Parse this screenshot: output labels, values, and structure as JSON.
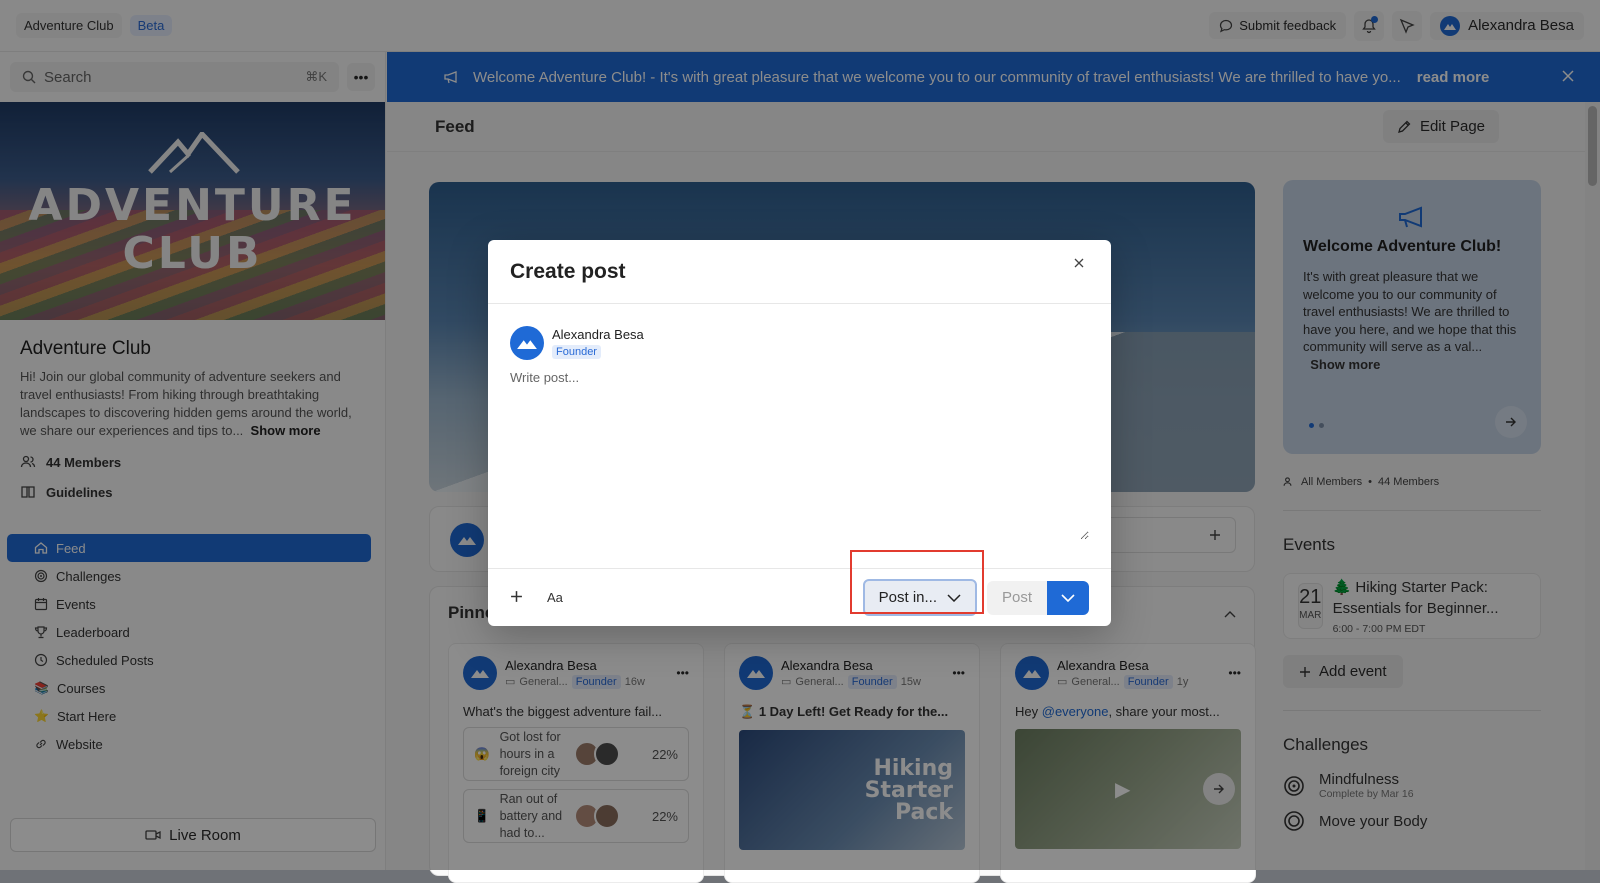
{
  "topbar": {
    "community": "Adventure Club",
    "beta": "Beta",
    "feedback": "Submit feedback",
    "user": "Alexandra Besa"
  },
  "sidebar": {
    "search_placeholder": "Search",
    "search_shortcut": "⌘K",
    "banner_text_1": "ADVENTURE",
    "banner_text_2": "CLUB",
    "title": "Adventure Club",
    "description": "Hi! Join our global community of adventure seekers and travel enthusiasts! From hiking through breathtaking landscapes to discovering hidden gems around the world, we share our experiences and tips to...",
    "show_more": "Show more",
    "members": "44 Members",
    "guidelines": "Guidelines",
    "nav": [
      {
        "label": "Feed",
        "icon": "home-icon"
      },
      {
        "label": "Challenges",
        "icon": "target-icon"
      },
      {
        "label": "Events",
        "icon": "calendar-icon"
      },
      {
        "label": "Leaderboard",
        "icon": "trophy-icon"
      },
      {
        "label": "Scheduled Posts",
        "icon": "clock-icon"
      },
      {
        "label": "Courses",
        "icon": "books-icon"
      },
      {
        "label": "Start Here",
        "icon": "star-icon"
      },
      {
        "label": "Website",
        "icon": "link-icon"
      }
    ],
    "live_room": "Live Room"
  },
  "announcement": {
    "text": "Welcome Adventure Club! - It's with great pleasure that we welcome you to our community of travel enthusiasts! We are thrilled to have yo...",
    "read_more": "read more"
  },
  "feed": {
    "title": "Feed",
    "edit_page": "Edit Page",
    "pinned_label": "Pinned",
    "cards": [
      {
        "author": "Alexandra Besa",
        "channel": "General...",
        "role": "Founder",
        "age": "16w",
        "text": "What's the biggest adventure fail...",
        "poll": [
          {
            "emoji": "😱",
            "text": "Got lost for hours in a foreign city",
            "pct": "22%"
          },
          {
            "emoji": "📱",
            "text": "Ran out of battery and had to...",
            "pct": "22%"
          }
        ]
      },
      {
        "author": "Alexandra Besa",
        "channel": "General...",
        "role": "Founder",
        "age": "15w",
        "text_prefix": "⏳",
        "text": "1 Day Left! Get Ready for the...",
        "image_text": "Hiking Starter Pack"
      },
      {
        "author": "Alexandra Besa",
        "channel": "General...",
        "role": "Founder",
        "age": "1y",
        "text": "Hey",
        "mention": "@everyone",
        "text_after": ", share your most..."
      }
    ]
  },
  "right": {
    "welcome_title": "Welcome Adventure Club!",
    "welcome_body": "It's with great pleasure that we welcome you to our community of travel enthusiasts! We are thrilled to have you here, and we hope that this community will serve as a val...",
    "welcome_more": "Show more",
    "all_members": "All Members",
    "members_count": "44 Members",
    "events_title": "Events",
    "event": {
      "day": "21",
      "month": "MAR",
      "title": "🌲 Hiking Starter Pack: Essentials for Beginner...",
      "time": "6:00 - 7:00 PM EDT"
    },
    "add_event": "Add event",
    "challenges_title": "Challenges",
    "challenges": [
      {
        "name": "Mindfulness",
        "sub": "Complete by Mar 16"
      },
      {
        "name": "Move your Body",
        "sub": ""
      }
    ]
  },
  "modal": {
    "title": "Create post",
    "author": "Alexandra Besa",
    "role": "Founder",
    "placeholder": "Write post...",
    "format_label": "Aa",
    "post_in": "Post in...",
    "post": "Post"
  },
  "colors": {
    "accent": "#1f6ad6",
    "highlight": "#e23b2f"
  }
}
